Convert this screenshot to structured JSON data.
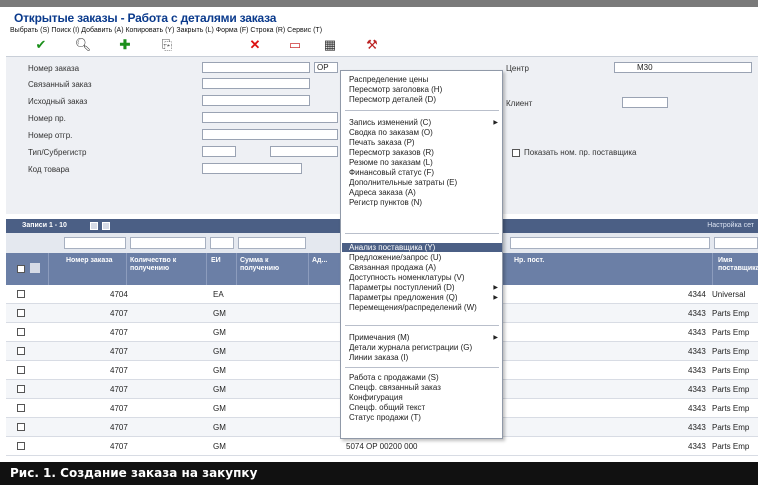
{
  "window": {
    "title": "Открытые заказы - Работа с деталями заказа"
  },
  "menubar": {
    "text": "Выбрать (S)  Поиск (I)  Добавить (A)  Копировать (Y)  Закрыть (L)  Форма (F)  Строка (R)  Сервис (T)"
  },
  "form": {
    "fields": [
      {
        "label": "Номер заказа",
        "value": "",
        "extra": "ОР"
      },
      {
        "label": "Связанный заказ",
        "value": ""
      },
      {
        "label": "Исходный заказ",
        "value": ""
      },
      {
        "label": "Номер пр.",
        "value": ""
      },
      {
        "label": "Номер отгр.",
        "value": ""
      },
      {
        "label": "Тип/Субрегистр",
        "value": ""
      },
      {
        "label": "Код товара",
        "value": ""
      }
    ],
    "right_label": "Центр",
    "right_value": "M30",
    "right_label2": "Клиент",
    "show_supplier_label": "Показать ном. пр. поставщика"
  },
  "grid": {
    "title": "Записи 1 - 10",
    "setup_label": "Настройка сет",
    "columns": [
      "Номер заказа",
      "Количество к получению",
      "ЕИ",
      "Сумма к получению",
      "Ад...",
      "",
      "",
      "Нр. пост.",
      "Имя поставщика"
    ],
    "rows": [
      {
        "order": "4704",
        "uom": "EA",
        "supplier_no": "4344",
        "supplier_name": "Universal"
      },
      {
        "order": "4707",
        "uom": "GM",
        "supplier_no": "4343",
        "supplier_name": "Parts Emp"
      },
      {
        "order": "4707",
        "uom": "GM",
        "supplier_no": "4343",
        "supplier_name": "Parts Emp"
      },
      {
        "order": "4707",
        "uom": "GM",
        "supplier_no": "4343",
        "supplier_name": "Parts Emp"
      },
      {
        "order": "4707",
        "uom": "GM",
        "supplier_no": "4343",
        "supplier_name": "Parts Emp"
      },
      {
        "order": "4707",
        "uom": "GM",
        "supplier_no": "4343",
        "supplier_name": "Parts Emp"
      },
      {
        "order": "4707",
        "uom": "GM",
        "supplier_no": "4343",
        "supplier_name": "Parts Emp"
      },
      {
        "order": "4707",
        "uom": "GM",
        "supplier_no": "4343",
        "supplier_name": "Parts Emp"
      },
      {
        "order": "4707",
        "uom": "GM",
        "supplier_no": "4343",
        "supplier_name": "Parts Emp",
        "mid": "5074   OP      00200    000"
      }
    ]
  },
  "context_menu": {
    "groups": [
      [
        "Распределение цены",
        "Пересмотр заголовка (H)",
        "Пересмотр деталей (D)"
      ],
      [
        "Запись изменений (C)",
        "Сводка по заказам (O)",
        "Печать заказа (P)",
        "Пересмотр заказов (R)",
        "Резюме по заказам (L)",
        "Финансовый статус (F)",
        "Дополнительные затраты (E)",
        "Адреса заказа (A)",
        "Регистр пунктов (N)"
      ],
      [
        "Анализ поставщика (Y)",
        "Предложение/запрос (U)",
        "Связанная продажа (A)",
        "Доступность номенклатуры (V)",
        "Параметры поступлений (D)",
        "Параметры предложения (Q)",
        "Перемещения/распределений (W)"
      ],
      [
        "Примечания (M)",
        "Детали журнала регистрации (G)",
        "Линии заказа (I)"
      ],
      [
        "Работа с продажами (S)",
        "Спецф. связанный заказ",
        "Конфигурация",
        "Спецф. общий текст",
        "Статус продажи (T)"
      ]
    ],
    "highlighted": "Анализ поставщика (Y)"
  },
  "caption": {
    "text": "Рис. 1. Создание заказа на закупку"
  }
}
